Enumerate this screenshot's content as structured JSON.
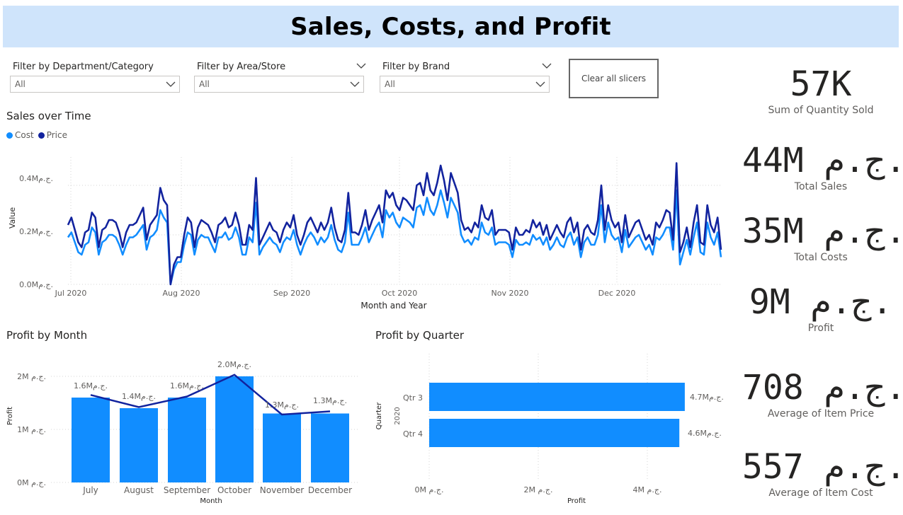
{
  "header": {
    "title": "Sales, Costs, and Profit"
  },
  "slicers": [
    {
      "label": "Filter by Department/Category",
      "value": "All"
    },
    {
      "label": "Filter by Area/Store",
      "value": "All"
    },
    {
      "label": "Filter by Brand",
      "value": "All"
    }
  ],
  "clear_button": {
    "label": "Clear all slicers"
  },
  "sales_chart": {
    "title": "Sales over Time",
    "legend": [
      {
        "name": "Cost",
        "color": "#118dff"
      },
      {
        "name": "Price",
        "color": "#12239e"
      }
    ],
    "ylabel": "Value",
    "xlabel": "Month and Year",
    "y_ticks": [
      "0.0Mج.م.",
      "0.2Mج.م.",
      "0.4Mج.م."
    ],
    "x_ticks": [
      "Jul 2020",
      "Aug 2020",
      "Sep 2020",
      "Oct 2020",
      "Nov 2020",
      "Dec 2020"
    ]
  },
  "profit_month": {
    "title": "Profit by Month",
    "ylabel": "Profit",
    "xlabel": "Month",
    "y_ticks": [
      "0M ج.م.",
      "1M ج.م.",
      "2M ج.م."
    ],
    "data_labels": [
      "1.6Mج.م.",
      "1.4Mج.م.",
      "1.6Mج.م.",
      "2.0Mج.م.",
      "1.3Mج.م.",
      "1.3Mج.م."
    ]
  },
  "profit_quarter": {
    "title": "Profit by Quarter",
    "ylabel": "Quarter",
    "year_label": "2020",
    "xlabel": "Profit",
    "x_ticks": [
      "0M ج.م.",
      "2M ج.م.",
      "4M ج.م."
    ],
    "data_labels": [
      "4.7Mج.م.",
      "4.6Mج.م."
    ]
  },
  "kpis": [
    {
      "value": "57K",
      "label": "Sum of Quantity Sold"
    },
    {
      "value": "44M ج.م.",
      "label": "Total Sales"
    },
    {
      "value": "35M ج.م.",
      "label": "Total Costs"
    },
    {
      "value": "9M ج.م.",
      "label": "Profit"
    },
    {
      "value": "708 ج.م.",
      "label": "Average of Item Price"
    },
    {
      "value": "557 ج.م.",
      "label": "Average of Item Cost"
    }
  ],
  "chart_data": [
    {
      "type": "line",
      "title": "Sales over Time",
      "xlabel": "Month and Year",
      "ylabel": "Value",
      "ylim": [
        0,
        0.5
      ],
      "x_start": "2020-07-01",
      "x_end": "2020-12-31",
      "series": [
        {
          "name": "Price",
          "color": "#12239e",
          "values": [
            0.24,
            0.27,
            0.22,
            0.17,
            0.15,
            0.21,
            0.22,
            0.29,
            0.27,
            0.15,
            0.22,
            0.23,
            0.26,
            0.26,
            0.25,
            0.21,
            0.15,
            0.21,
            0.24,
            0.24,
            0.25,
            0.28,
            0.31,
            0.18,
            0.24,
            0.26,
            0.28,
            0.39,
            0.34,
            0.32,
            0.0,
            0.08,
            0.11,
            0.11,
            0.2,
            0.27,
            0.25,
            0.15,
            0.23,
            0.26,
            0.25,
            0.24,
            0.21,
            0.17,
            0.24,
            0.25,
            0.27,
            0.23,
            0.24,
            0.29,
            0.24,
            0.16,
            0.16,
            0.24,
            0.22,
            0.43,
            0.16,
            0.19,
            0.22,
            0.25,
            0.22,
            0.21,
            0.17,
            0.22,
            0.25,
            0.23,
            0.28,
            0.2,
            0.16,
            0.2,
            0.25,
            0.27,
            0.24,
            0.21,
            0.25,
            0.22,
            0.25,
            0.31,
            0.23,
            0.18,
            0.17,
            0.22,
            0.37,
            0.21,
            0.21,
            0.2,
            0.24,
            0.3,
            0.22,
            0.26,
            0.29,
            0.32,
            0.25,
            0.38,
            0.35,
            0.37,
            0.32,
            0.3,
            0.35,
            0.34,
            0.32,
            0.3,
            0.4,
            0.41,
            0.36,
            0.45,
            0.38,
            0.36,
            0.41,
            0.48,
            0.42,
            0.34,
            0.45,
            0.41,
            0.37,
            0.26,
            0.22,
            0.23,
            0.21,
            0.25,
            0.23,
            0.32,
            0.27,
            0.26,
            0.3,
            0.2,
            0.22,
            0.22,
            0.22,
            0.21,
            0.14,
            0.23,
            0.2,
            0.2,
            0.22,
            0.21,
            0.26,
            0.23,
            0.25,
            0.2,
            0.24,
            0.18,
            0.21,
            0.24,
            0.21,
            0.19,
            0.25,
            0.27,
            0.21,
            0.25,
            0.14,
            0.22,
            0.24,
            0.21,
            0.2,
            0.26,
            0.4,
            0.22,
            0.32,
            0.26,
            0.23,
            0.25,
            0.17,
            0.28,
            0.19,
            0.22,
            0.25,
            0.26,
            0.22,
            0.18,
            0.2,
            0.16,
            0.25,
            0.23,
            0.26,
            0.3,
            0.29,
            0.18,
            0.49,
            0.13,
            0.17,
            0.23,
            0.15,
            0.25,
            0.32,
            0.17,
            0.16,
            0.32,
            0.24,
            0.21,
            0.27,
            0.14
          ]
        },
        {
          "name": "Cost",
          "color": "#118dff",
          "values": [
            0.19,
            0.21,
            0.17,
            0.13,
            0.12,
            0.16,
            0.17,
            0.23,
            0.21,
            0.12,
            0.17,
            0.18,
            0.2,
            0.2,
            0.19,
            0.16,
            0.12,
            0.16,
            0.19,
            0.19,
            0.2,
            0.22,
            0.24,
            0.14,
            0.19,
            0.2,
            0.22,
            0.3,
            0.27,
            0.25,
            0.0,
            0.06,
            0.09,
            0.09,
            0.16,
            0.21,
            0.2,
            0.12,
            0.18,
            0.2,
            0.19,
            0.19,
            0.16,
            0.13,
            0.19,
            0.19,
            0.21,
            0.18,
            0.19,
            0.23,
            0.19,
            0.12,
            0.12,
            0.19,
            0.17,
            0.33,
            0.12,
            0.15,
            0.17,
            0.19,
            0.17,
            0.16,
            0.13,
            0.17,
            0.19,
            0.18,
            0.22,
            0.16,
            0.12,
            0.16,
            0.19,
            0.21,
            0.19,
            0.16,
            0.19,
            0.17,
            0.19,
            0.24,
            0.18,
            0.14,
            0.13,
            0.17,
            0.29,
            0.16,
            0.16,
            0.16,
            0.19,
            0.23,
            0.17,
            0.2,
            0.23,
            0.25,
            0.19,
            0.3,
            0.27,
            0.29,
            0.25,
            0.23,
            0.27,
            0.26,
            0.25,
            0.23,
            0.31,
            0.32,
            0.28,
            0.35,
            0.3,
            0.28,
            0.32,
            0.38,
            0.33,
            0.27,
            0.35,
            0.32,
            0.29,
            0.2,
            0.17,
            0.18,
            0.16,
            0.19,
            0.18,
            0.25,
            0.21,
            0.2,
            0.23,
            0.16,
            0.17,
            0.17,
            0.17,
            0.16,
            0.11,
            0.18,
            0.16,
            0.16,
            0.17,
            0.16,
            0.2,
            0.18,
            0.19,
            0.16,
            0.19,
            0.14,
            0.16,
            0.19,
            0.16,
            0.15,
            0.19,
            0.21,
            0.16,
            0.19,
            0.11,
            0.17,
            0.19,
            0.16,
            0.16,
            0.2,
            0.32,
            0.17,
            0.25,
            0.2,
            0.18,
            0.19,
            0.13,
            0.22,
            0.15,
            0.17,
            0.19,
            0.2,
            0.17,
            0.14,
            0.16,
            0.12,
            0.19,
            0.18,
            0.2,
            0.23,
            0.23,
            0.14,
            0.38,
            0.08,
            0.13,
            0.18,
            0.12,
            0.19,
            0.25,
            0.13,
            0.12,
            0.25,
            0.19,
            0.16,
            0.21,
            0.11
          ]
        }
      ]
    },
    {
      "type": "bar",
      "title": "Profit by Month",
      "xlabel": "Month",
      "ylabel": "Profit",
      "categories": [
        "July",
        "August",
        "September",
        "October",
        "November",
        "December"
      ],
      "values": [
        1.6,
        1.4,
        1.6,
        2.0,
        1.3,
        1.3
      ],
      "line_values": [
        1.65,
        1.42,
        1.62,
        2.03,
        1.28,
        1.34
      ],
      "ylim": [
        0,
        2.2
      ]
    },
    {
      "type": "bar",
      "orientation": "horizontal",
      "title": "Profit by Quarter",
      "xlabel": "Profit",
      "ylabel": "Quarter",
      "categories": [
        "Qtr 3",
        "Qtr 4"
      ],
      "values": [
        4.7,
        4.6
      ],
      "xlim": [
        0,
        5.4
      ]
    }
  ]
}
